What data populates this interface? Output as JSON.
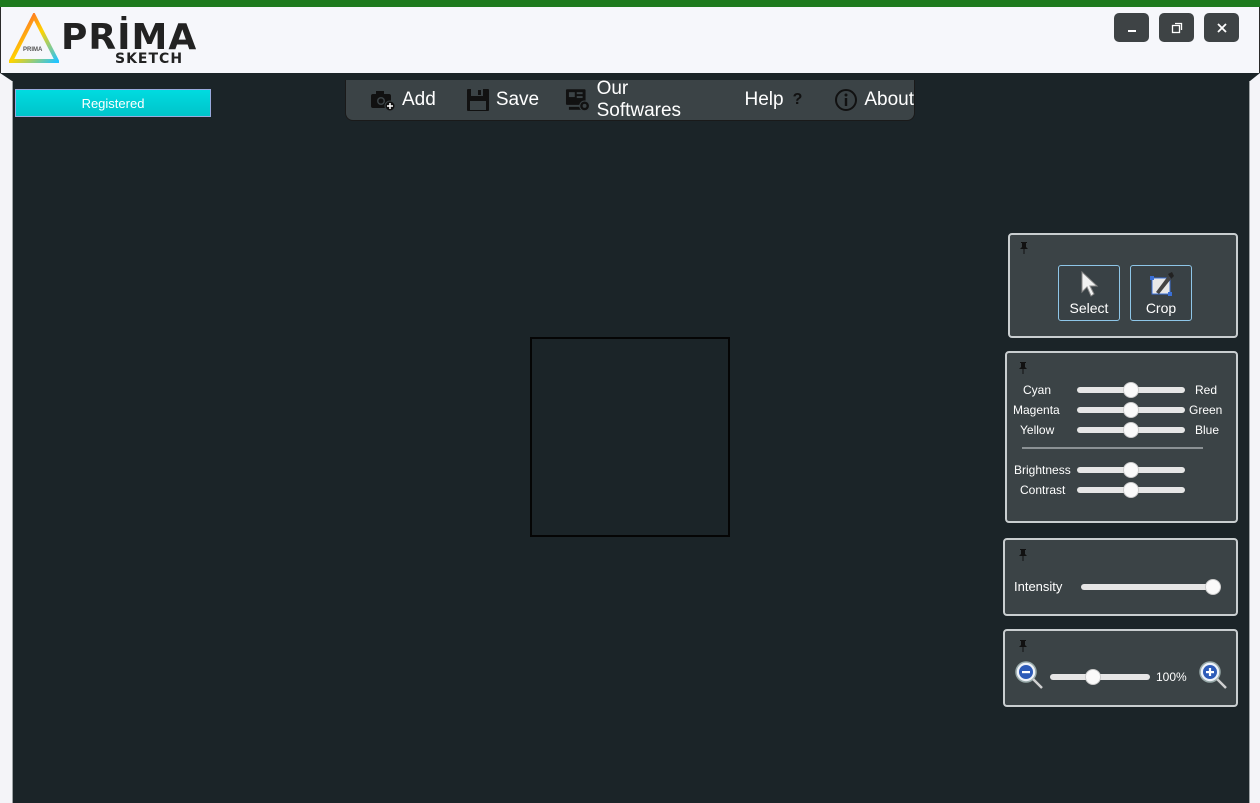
{
  "app": {
    "logo_title": "PRİMA",
    "logo_subtitle": "SKETCH",
    "logo_mark_text": "PRIMA"
  },
  "window_controls": {
    "minimize": "minimize-icon",
    "restore": "restore-icon",
    "close": "close-icon"
  },
  "status": {
    "registered_label": "Registered"
  },
  "menu": {
    "add_label": "Add",
    "save_label": "Save",
    "our_softwares_label": "Our Softwares",
    "help_label": "Help",
    "help_glyph": "?",
    "about_label": "About"
  },
  "tools": {
    "select_label": "Select",
    "crop_label": "Crop"
  },
  "color_balance": {
    "rows": [
      {
        "left": "Cyan",
        "right": "Red",
        "value": 0.5
      },
      {
        "left": "Magenta",
        "right": "Green",
        "value": 0.5
      },
      {
        "left": "Yellow",
        "right": "Blue",
        "value": 0.5
      }
    ],
    "brightness_label": "Brightness",
    "brightness_value": 0.5,
    "contrast_label": "Contrast",
    "contrast_value": 0.5
  },
  "intensity": {
    "label": "Intensity",
    "value": 1.0
  },
  "zoom": {
    "value_text": "100%",
    "value": 0.35
  },
  "colors": {
    "accent": "#00d4d9",
    "background": "#1b2428",
    "panel": "#3b4346"
  }
}
